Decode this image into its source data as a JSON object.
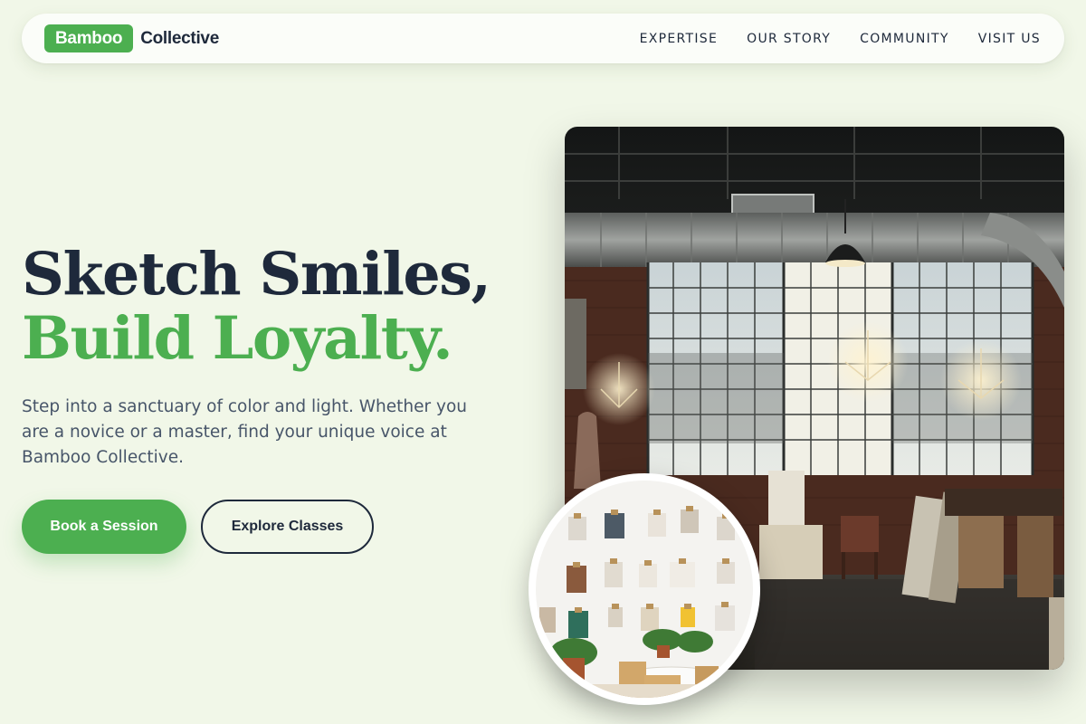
{
  "brand": {
    "badge": "Bamboo",
    "word": "Collective",
    "accent_color": "#4caf50",
    "ink_color": "#1e293b",
    "background_color": "#f1f7e8"
  },
  "nav": {
    "links": [
      "EXPERTISE",
      "OUR STORY",
      "COMMUNITY",
      "VISIT US"
    ]
  },
  "hero": {
    "headline_line1": "Sketch Smiles,",
    "headline_line2": "Build Loyalty.",
    "lede": "Step into a sanctuary of color and light. Whether you are a novice or a master, find your unique voice at Bamboo Collective.",
    "primary_cta": "Book a Session",
    "secondary_cta": "Explore Classes"
  },
  "images": {
    "main": "industrial-studio-photo",
    "inset": "gallery-wall-photo"
  }
}
